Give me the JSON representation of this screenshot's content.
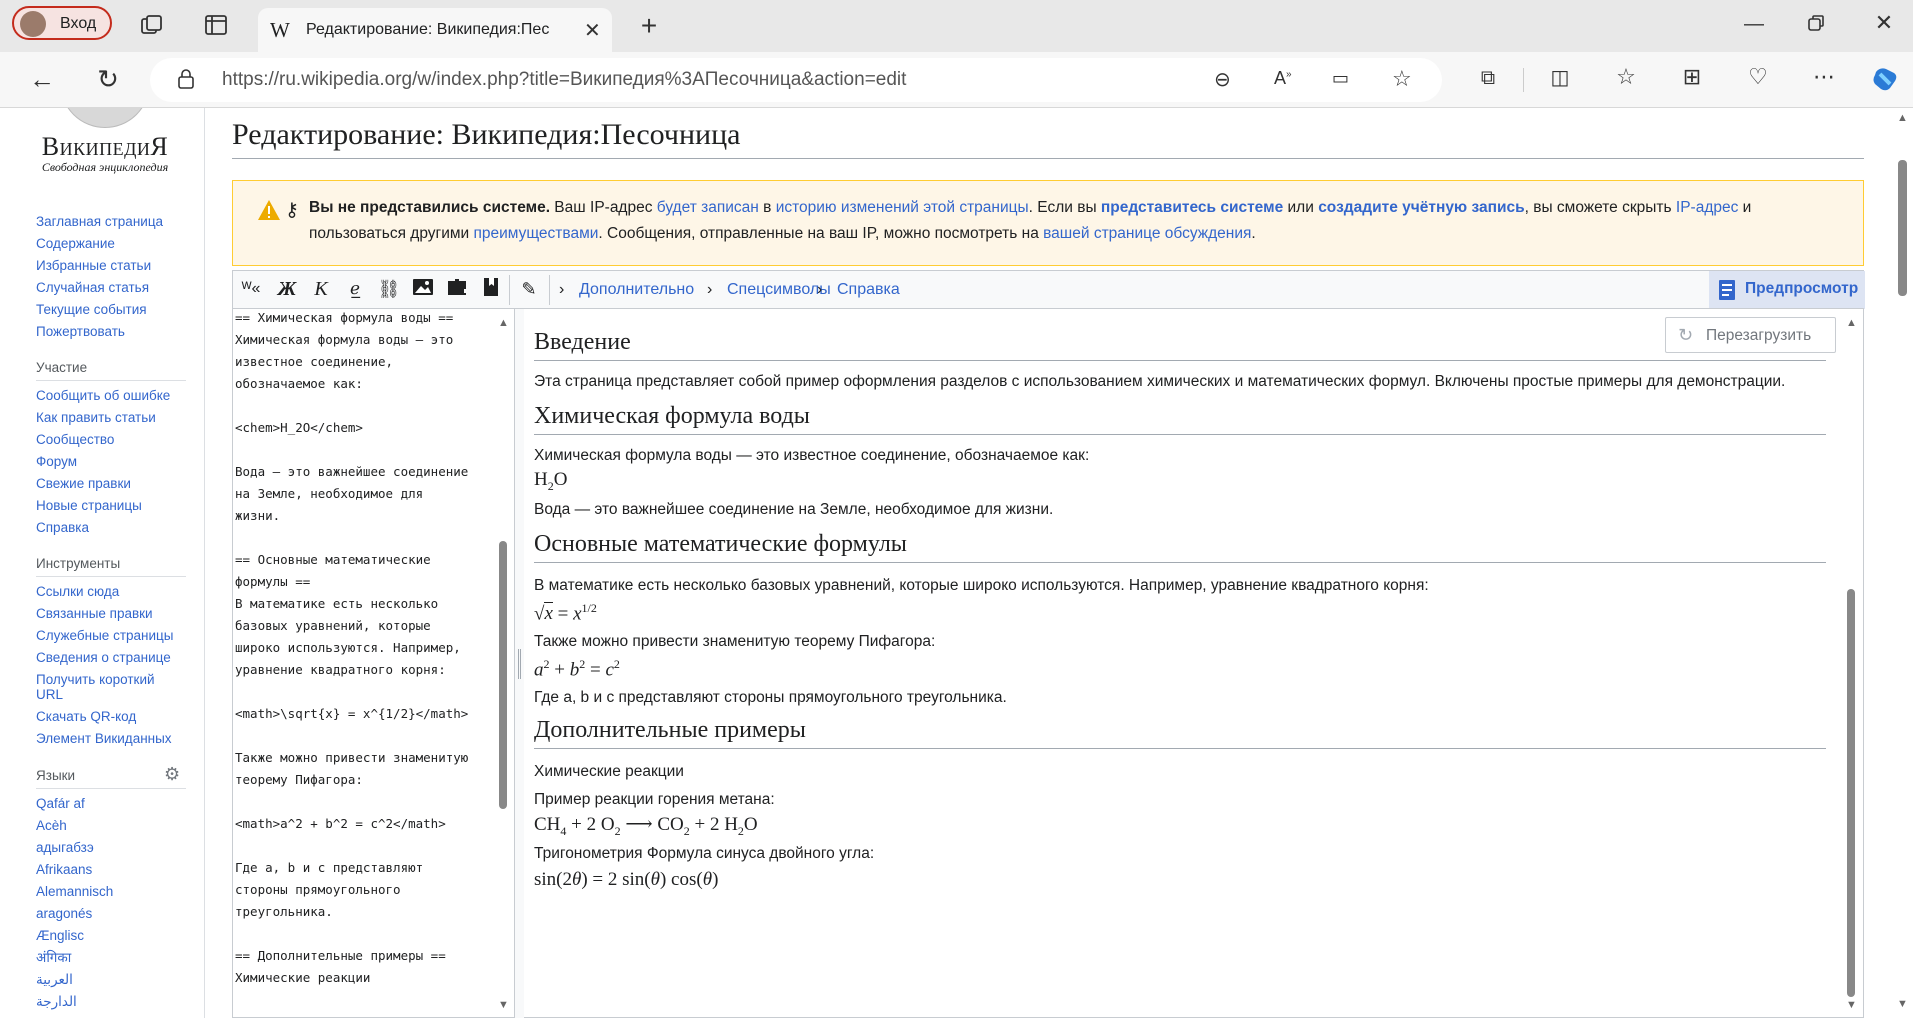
{
  "browser": {
    "profile_label": "Вход",
    "tab_title": "Редактирование: Википедия:Пес",
    "url": "https://ru.wikipedia.org/w/index.php?title=Википедия%3AПесочница&action=edit"
  },
  "sidebar": {
    "logo_title": "ВикипедиЯ",
    "logo_subtitle": "Свободная энциклопедия",
    "nav": [
      "Заглавная страница",
      "Содержание",
      "Избранные статьи",
      "Случайная статья",
      "Текущие события",
      "Пожертвовать"
    ],
    "participation_head": "Участие",
    "participation": [
      "Сообщить об ошибке",
      "Как править статьи",
      "Сообщество",
      "Форум",
      "Свежие правки",
      "Новые страницы",
      "Справка"
    ],
    "tools_head": "Инструменты",
    "tools": [
      "Ссылки сюда",
      "Связанные правки",
      "Служебные страницы",
      "Сведения о странице",
      "Получить короткий",
      "URL",
      "Скачать QR-код",
      "Элемент Викиданных"
    ],
    "languages_head": "Языки",
    "languages": [
      "Qafár af",
      "Acèh",
      "адыгабзэ",
      "Afrikaans",
      "Alemannisch",
      "aragonés",
      "Ænglisc",
      "अंगिका",
      "العربية",
      "الدارجة"
    ]
  },
  "page": {
    "title": "Редактирование: Википедия:Песочница"
  },
  "notice": {
    "bold1": "Вы не представились системе.",
    "t1": " Ваш IP-адрес ",
    "l1": "будет записан",
    "t2": " в ",
    "l2": "историю изменений этой страницы",
    "t3": ". Если вы ",
    "b2": "представитесь системе",
    "t4": " или ",
    "b3": "создадите учётную запись",
    "t5": ", вы сможете скрыть ",
    "l3": "IP-адрес",
    "t6": " и",
    "t7": "пользоваться другими ",
    "l4": "преимуществами",
    "t8": ". Сообщения, отправленные на ваш IP, можно посмотреть на ",
    "l5": "вашей странице обсуждения",
    "t9": "."
  },
  "toolbar": {
    "advanced": "Дополнительно",
    "special": "Спецсимволы",
    "help": "Справка",
    "preview": "Предпросмотр"
  },
  "editor_lines": [
    "== Химическая формула воды ==",
    "Химическая формула воды — это",
    "известное соединение,",
    "обозначаемое как:",
    "",
    "<chem>H_2O</chem>",
    "",
    "Вода — это важнейшее соединение",
    "на Земле, необходимое для",
    "жизни.",
    "",
    "== Основные математические",
    "формулы ==",
    "В математике есть несколько",
    "базовых уравнений, которые",
    "широко используются. Например,",
    "уравнение квадратного корня:",
    "",
    "<math>\\sqrt{x} = x^{1/2}</math>",
    "",
    "Также можно привести знаменитую",
    "теорему Пифагора:",
    "",
    "<math>a^2 + b^2 = c^2</math>",
    "",
    "Где a, b и c представляют",
    "стороны прямоугольного",
    "треугольника.",
    "",
    "== Дополнительные примеры ==",
    "Химические реакции"
  ],
  "preview": {
    "reload": "Перезагрузить",
    "h_intro": "Введение",
    "p_intro": "Эта страница представляет собой пример оформления разделов с использованием химических и математических формул. Включены простые примеры для демонстрации.",
    "h_water": "Химическая формула воды",
    "p_water1": "Химическая формула воды — это известное соединение, обозначаемое как:",
    "p_water2": "Вода — это важнейшее соединение на Земле, необходимое для жизни.",
    "h_math": "Основные математические формулы",
    "p_math1": "В математике есть несколько базовых уравнений, которые широко используются. Например, уравнение квадратного корня:",
    "p_math2": "Также можно привести знаменитую теорему Пифагора:",
    "p_math3": "Где a, b и c представляют стороны прямоугольного треугольника.",
    "h_more": "Дополнительные примеры",
    "p_more1": "Химические реакции",
    "p_more2": "Пример реакции горения метана:",
    "p_more3": "Тригонометрия Формула синуса двойного угла:"
  },
  "colors": {
    "link": "#3366cc",
    "notice_bg": "#fef6e7",
    "notice_border": "#ffcc33"
  }
}
